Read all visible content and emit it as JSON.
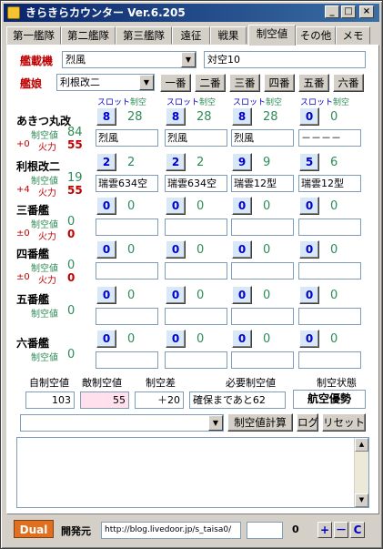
{
  "window": {
    "title": "きらきらカウンター  Ver.6.205",
    "minimize": "_",
    "maximize": "□",
    "close": "×"
  },
  "tabs": [
    "第一艦隊",
    "第二艦隊",
    "第三艦隊",
    "遠征",
    "戦果",
    "制空値",
    "その他",
    "メモ"
  ],
  "header": {
    "carrier_label": "艦載機",
    "carrier_value": "烈風",
    "plane_info": "対空10",
    "ship_label": "艦娘",
    "ship_value": "利根改二",
    "order_buttons": [
      "一番",
      "二番",
      "三番",
      "四番",
      "五番",
      "六番"
    ]
  },
  "col_headers": {
    "slot": "スロット",
    "air": "制空"
  },
  "ships": [
    {
      "name": "あきつ丸改",
      "air_label": "制空値",
      "air": "84",
      "mod": "+0",
      "fire_label": "火力",
      "fire": "55",
      "slots": [
        {
          "n": "8",
          "a": "28",
          "eq": "烈風"
        },
        {
          "n": "8",
          "a": "28",
          "eq": "烈風"
        },
        {
          "n": "8",
          "a": "28",
          "eq": "烈風"
        },
        {
          "n": "0",
          "a": "0",
          "eq": "－－－－"
        }
      ]
    },
    {
      "name": "利根改二",
      "air_label": "制空値",
      "air": "19",
      "mod": "+4",
      "fire_label": "火力",
      "fire": "55",
      "slots": [
        {
          "n": "2",
          "a": "2",
          "eq": "瑞雲634空"
        },
        {
          "n": "2",
          "a": "2",
          "eq": "瑞雲634空"
        },
        {
          "n": "9",
          "a": "9",
          "eq": "瑞雲12型"
        },
        {
          "n": "5",
          "a": "6",
          "eq": "瑞雲12型"
        }
      ]
    },
    {
      "name": "三番艦",
      "air_label": "制空値",
      "air": "0",
      "mod": "±0",
      "fire_label": "火力",
      "fire": "0",
      "slots": [
        {
          "n": "0",
          "a": "0",
          "eq": ""
        },
        {
          "n": "0",
          "a": "0",
          "eq": ""
        },
        {
          "n": "0",
          "a": "0",
          "eq": ""
        },
        {
          "n": "0",
          "a": "0",
          "eq": ""
        }
      ]
    },
    {
      "name": "四番艦",
      "air_label": "制空値",
      "air": "0",
      "mod": "±0",
      "fire_label": "火力",
      "fire": "0",
      "slots": [
        {
          "n": "0",
          "a": "0",
          "eq": ""
        },
        {
          "n": "0",
          "a": "0",
          "eq": ""
        },
        {
          "n": "0",
          "a": "0",
          "eq": ""
        },
        {
          "n": "0",
          "a": "0",
          "eq": ""
        }
      ]
    },
    {
      "name": "五番艦",
      "air_label": "制空値",
      "air": "0",
      "mod": "",
      "fire_label": "",
      "fire": "",
      "slots": [
        {
          "n": "0",
          "a": "0",
          "eq": ""
        },
        {
          "n": "0",
          "a": "0",
          "eq": ""
        },
        {
          "n": "0",
          "a": "0",
          "eq": ""
        },
        {
          "n": "0",
          "a": "0",
          "eq": ""
        }
      ]
    },
    {
      "name": "六番艦",
      "air_label": "制空値",
      "air": "0",
      "mod": "",
      "fire_label": "",
      "fire": "",
      "slots": [
        {
          "n": "0",
          "a": "0",
          "eq": ""
        },
        {
          "n": "0",
          "a": "0",
          "eq": ""
        },
        {
          "n": "0",
          "a": "0",
          "eq": ""
        },
        {
          "n": "0",
          "a": "0",
          "eq": ""
        }
      ]
    }
  ],
  "summary": {
    "own_label": "自制空値",
    "own": "103",
    "enemy_label": "敵制空値",
    "enemy": "55",
    "diff_label": "制空差",
    "diff": "＋20",
    "need_label": "必要制空値",
    "need": "確保まであと62",
    "state_label": "制空状態",
    "state": "航空優勢"
  },
  "actions": {
    "calc": "制空値計算",
    "log": "ログ",
    "reset": "リセット",
    "combo_value": ""
  },
  "log_text": "",
  "footer": {
    "dual": "Dual",
    "dev_label": "開発元",
    "url": "http://blog.livedoor.jp/s_taisa0/",
    "counter_field": "",
    "count": "0",
    "plus": "+",
    "minus": "－",
    "clear": "C"
  },
  "colors": {
    "title_from": "#0a246a",
    "title_to": "#3a6ea5",
    "air_green": "#2e8b57",
    "fire_red": "#c00000",
    "slot_blue": "#0000cc",
    "dual_orange": "#e07020",
    "enemy_pink": "#ffe0ec"
  }
}
